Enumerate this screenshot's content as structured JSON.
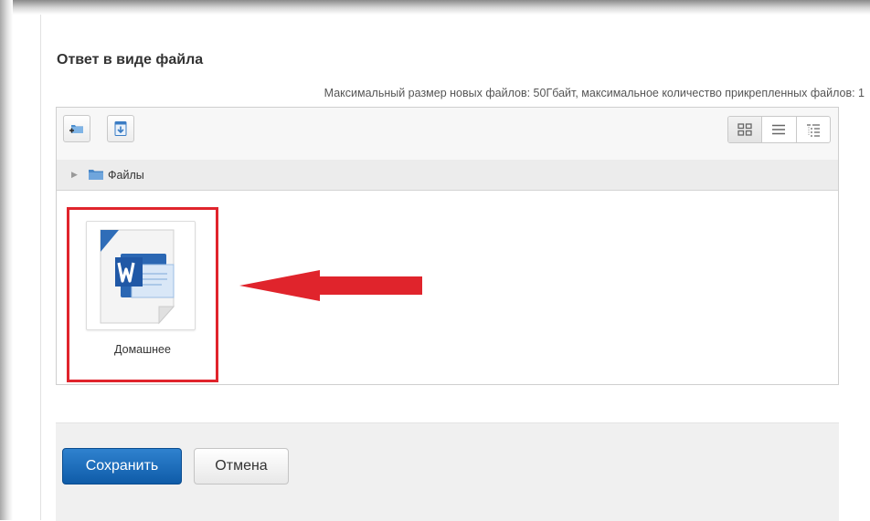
{
  "section": {
    "title": "Ответ в виде файла",
    "limits_text": "Максимальный размер новых файлов: 50Гбайт, максимальное количество прикрепленных файлов: 1"
  },
  "filepicker": {
    "toolbar": {
      "buttons": [
        {
          "name": "create-folder",
          "icon": "folder-plus-icon"
        },
        {
          "name": "download",
          "icon": "download-icon"
        }
      ],
      "view_modes": [
        {
          "name": "icons",
          "icon": "grid-view-icon",
          "selected": true
        },
        {
          "name": "list",
          "icon": "list-view-icon",
          "selected": false
        },
        {
          "name": "tree",
          "icon": "tree-view-icon",
          "selected": false
        }
      ]
    },
    "path": {
      "label": "Файлы",
      "icon": "folder-icon"
    },
    "files": [
      {
        "name": "Домашнее",
        "icon": "word-document-icon"
      }
    ]
  },
  "annotation": {
    "highlight_color": "#e0242c",
    "arrow_color": "#e0242c"
  },
  "actions": {
    "save_label": "Сохранить",
    "cancel_label": "Отмена"
  },
  "colors": {
    "primary_button": "#1565b4",
    "highlight": "#e0242c"
  }
}
